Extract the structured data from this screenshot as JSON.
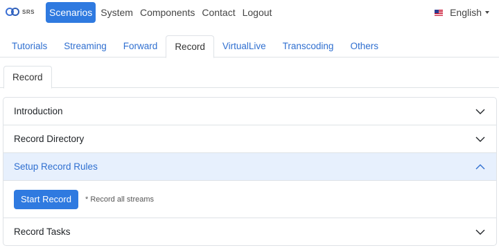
{
  "brand": {
    "logo_text": "SRS"
  },
  "nav": {
    "items": [
      {
        "label": "Scenarios",
        "active": true
      },
      {
        "label": "System",
        "active": false
      },
      {
        "label": "Components",
        "active": false
      },
      {
        "label": "Contact",
        "active": false
      },
      {
        "label": "Logout",
        "active": false
      }
    ],
    "language": "English"
  },
  "tabs": [
    {
      "label": "Tutorials"
    },
    {
      "label": "Streaming"
    },
    {
      "label": "Forward"
    },
    {
      "label": "Record",
      "active": true
    },
    {
      "label": "VirtualLive"
    },
    {
      "label": "Transcoding"
    },
    {
      "label": "Others"
    }
  ],
  "subtab": {
    "label": "Record"
  },
  "accordion": {
    "items": [
      {
        "title": "Introduction",
        "open": false
      },
      {
        "title": "Record Directory",
        "open": false
      },
      {
        "title": "Setup Record Rules",
        "open": true
      },
      {
        "title": "Record Tasks",
        "open": false
      }
    ],
    "rules": {
      "button_label": "Start Record",
      "hint": "* Record all streams"
    }
  },
  "colors": {
    "primary": "#2f7ae0",
    "link": "#2f6fd0",
    "open_header_bg": "#e7f0fd"
  }
}
